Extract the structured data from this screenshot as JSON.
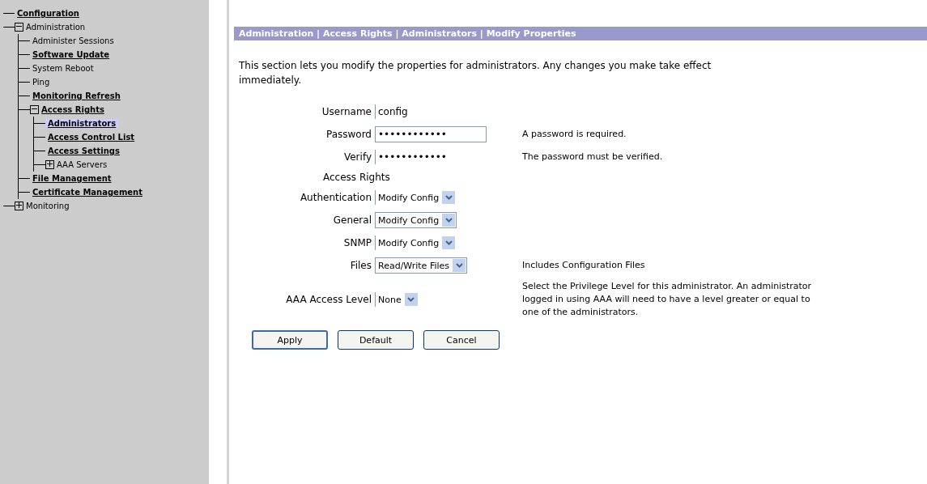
{
  "sidebar": {
    "items": [
      {
        "label": "Configuration",
        "link": true,
        "selected": false
      },
      {
        "label": "Administration",
        "link": false,
        "selected": false,
        "expanded": true,
        "children": [
          {
            "label": "Administer Sessions",
            "link": false,
            "selected": false
          },
          {
            "label": "Software Update",
            "link": true,
            "selected": false
          },
          {
            "label": "System Reboot",
            "link": false,
            "selected": false
          },
          {
            "label": "Ping",
            "link": false,
            "selected": false
          },
          {
            "label": "Monitoring Refresh",
            "link": true,
            "selected": false
          },
          {
            "label": "Access Rights",
            "link": true,
            "selected": false,
            "expanded": true,
            "children": [
              {
                "label": "Administrators",
                "link": true,
                "selected": true
              },
              {
                "label": "Access Control List",
                "link": true,
                "selected": false
              },
              {
                "label": "Access Settings",
                "link": true,
                "selected": false
              },
              {
                "label": "AAA Servers",
                "link": false,
                "selected": false,
                "expanded": false
              }
            ]
          },
          {
            "label": "File Management",
            "link": true,
            "selected": false
          },
          {
            "label": "Certificate Management",
            "link": true,
            "selected": false
          }
        ]
      },
      {
        "label": "Monitoring",
        "link": false,
        "selected": false,
        "expanded": false
      }
    ]
  },
  "header": "Administration | Access Rights | Administrators | Modify Properties",
  "intro": "This section lets you modify the properties for administrators. Any changes you make take effect immediately.",
  "fields": [
    {
      "kind": "text",
      "label": "Username",
      "value": "config",
      "disabled": true
    },
    {
      "kind": "password",
      "label": "Password",
      "value": "••••••••••••",
      "disabled": false,
      "note": "A password is required."
    },
    {
      "kind": "password",
      "label": "Verify",
      "value": "••••••••••••",
      "disabled": true,
      "note": "The password must be verified."
    },
    {
      "kind": "heading",
      "label": "Access Rights"
    },
    {
      "kind": "select",
      "label": "Authentication",
      "value": "Modify Config",
      "disabled": true
    },
    {
      "kind": "select",
      "label": "General",
      "value": "Modify Config",
      "disabled": false
    },
    {
      "kind": "select",
      "label": "SNMP",
      "value": "Modify Config",
      "disabled": true
    },
    {
      "kind": "select",
      "label": "Files",
      "value": "Read/Write Files",
      "disabled": false,
      "note": "Includes Configuration Files"
    },
    {
      "kind": "select",
      "label": "AAA Access Level",
      "value": "None",
      "disabled": true,
      "note": "Select the Privilege Level for this administrator. An administrator logged in using AAA will need to have a level greater or equal to one of the administrators."
    }
  ],
  "buttons": [
    {
      "label": "Apply",
      "focused": true
    },
    {
      "label": "Default",
      "focused": false
    },
    {
      "label": "Cancel",
      "focused": false
    }
  ]
}
